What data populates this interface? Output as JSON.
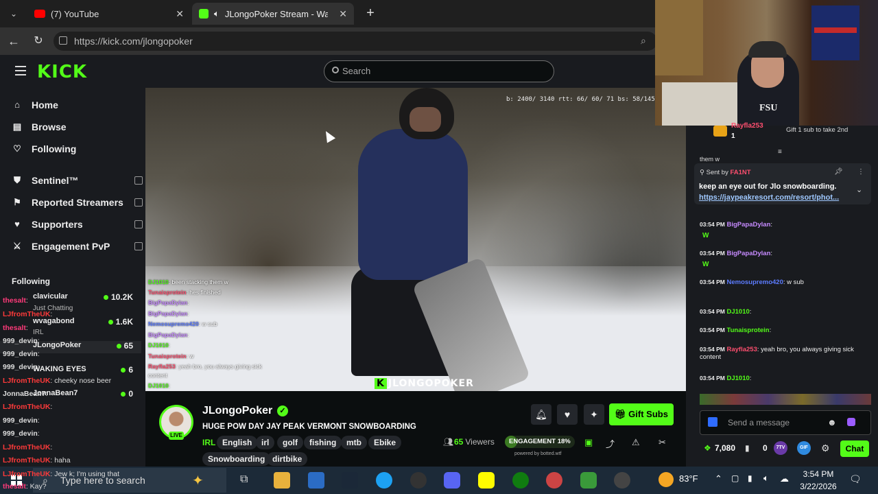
{
  "browser": {
    "tabs": [
      {
        "label": "(7) YouTube"
      },
      {
        "label": "JLongoPoker Stream - Watch"
      }
    ],
    "url": "https://kick.com/jlongopoker"
  },
  "kick": {
    "logo": "KICK",
    "search_placeholder": "Search",
    "nav": [
      {
        "label": "Home",
        "icon": "home-icon"
      },
      {
        "label": "Browse",
        "icon": "browse-icon"
      },
      {
        "label": "Following",
        "icon": "heart-icon"
      },
      {
        "label": "Sentinel™",
        "icon": "shield-icon"
      },
      {
        "label": "Reported Streamers",
        "icon": "flag-icon"
      },
      {
        "label": "Supporters",
        "icon": "heart-icon"
      },
      {
        "label": "Engagement PvP",
        "icon": "swords-icon"
      }
    ],
    "following_title": "Following",
    "following": [
      {
        "name": "clavicular",
        "count": "10.2K"
      },
      {
        "name": "wvagabond",
        "count": "1.6K"
      },
      {
        "name": "JLongoPoker",
        "count": "65"
      },
      {
        "name": "WAKING EYES",
        "count": "6"
      },
      {
        "name": "JonnaBean7",
        "count": "0"
      }
    ],
    "overlay_chat": [
      {
        "user": "thesalt",
        "text": ":"
      },
      {
        "user": "LJfromTheUK",
        "text": ":"
      },
      {
        "user": "thesalt",
        "text": ":"
      },
      {
        "user": "999_devin",
        "text": ":"
      },
      {
        "user": "999_devin",
        "text": ":"
      },
      {
        "user": "999_devin",
        "text": ":"
      },
      {
        "user": "LJfromTheUK",
        "text": ": cheeky nose beer"
      },
      {
        "user": "JonnaBean7",
        "text": ":"
      },
      {
        "user": "LJfromTheUK",
        "text": ":"
      },
      {
        "user": "999_devin",
        "text": ":"
      },
      {
        "user": "999_devin",
        "text": ":"
      },
      {
        "user": "LJfromTheUK",
        "text": ":"
      },
      {
        "user": "LJfromTheUK",
        "text": ": haha"
      },
      {
        "user": "LJfromTheUK",
        "text": ": Jew k; I'm using that"
      },
      {
        "user": "thesalt",
        "text": ": Kay?"
      }
    ],
    "overlay_extra": [
      "Just Chatting",
      "IRL"
    ]
  },
  "video": {
    "stats": "b: 2400/ 3140 rtt:  66/ 60/ 71 bs:  58/145/",
    "watermark": "JLONGOPOKER",
    "chat": [
      {
        "user": "DJ1010",
        "text": ": been stacking them w"
      },
      {
        "user": "Tunaisprotein",
        "text": ": hes finished"
      },
      {
        "user": "BigPapaDylan",
        "text": ":"
      },
      {
        "user": "BigPapaDylan",
        "text": ":"
      },
      {
        "user": "Nemosupremo420",
        "text": ": w sub"
      },
      {
        "user": "BigPapaDylan",
        "text": ":"
      },
      {
        "user": "DJ1010",
        "text": ":"
      },
      {
        "user": "Tunaisprotein",
        "text": ": w"
      },
      {
        "user": "Rayfla253",
        "text": ": yeah bro, you always giving sick"
      },
      {
        "user": "",
        "text": "content"
      },
      {
        "user": "DJ1010",
        "text": ":"
      }
    ]
  },
  "stream": {
    "name": "JLongoPoker",
    "live": "LIVE",
    "title": "HUGE POW DAY JAY PEAK VERMONT SNOWBOARDING",
    "category": "IRL",
    "tags": [
      "English",
      "irl",
      "golf",
      "fishing",
      "mtb",
      "Ebike",
      "Snowboarding",
      "dirtbike"
    ],
    "viewers": "65",
    "viewers_label": "Viewers",
    "engagement_label": "ENGAGEMENT 18%",
    "engagement_pct": 18,
    "powered_by": "powered by botted.wtf",
    "gift_subs": "Gift Subs"
  },
  "webcam": {
    "shirt_text": "FSU"
  },
  "chat": {
    "top_user": "Rayfla253",
    "top_count": "1",
    "gift_prompt": "Gift 1 sub to take 2nd",
    "cut_text": "them w",
    "pinned_label": "Sent by",
    "pinned_user": "FA1NT",
    "pinned_text": "keep an eye out for Jlo snowboarding.",
    "pinned_link": "https://jaypeakresort.com/resort/phot...",
    "messages": [
      {
        "time": "03:54 PM",
        "user": "BigPapaDylan",
        "text": ":",
        "color": "#c78bff"
      },
      {
        "time": "03:54 PM",
        "user": "BigPapaDylan",
        "text": ":",
        "color": "#c78bff"
      },
      {
        "time": "03:54 PM",
        "user": "Nemosupremo420",
        "text": ": w sub",
        "color": "#5c7cff"
      },
      {
        "time": "03:54 PM",
        "user": "DJ1010",
        "text": ":",
        "color": "#53fc18"
      },
      {
        "time": "03:54 PM",
        "user": "Tunaisprotein",
        "text": ":",
        "color": "#53fc18"
      },
      {
        "time": "03:54 PM",
        "user": "Rayfla253",
        "text": ": yeah bro, you always giving sick content",
        "color": "#ff4f6f"
      },
      {
        "time": "03:54 PM",
        "user": "DJ1010",
        "text": ":",
        "color": "#53fc18"
      }
    ],
    "input_placeholder": "Send a message",
    "points": "7,080",
    "zero": "0",
    "badges": [
      "7TV",
      "GIF"
    ],
    "chat_button": "Chat"
  },
  "taskbar": {
    "search_placeholder": "Type here to search",
    "weather": "83°F",
    "time": "3:54 PM",
    "date": "3/22/2026"
  },
  "colors": {
    "kick_green": "#53fc18",
    "bg": "#0b0e0f",
    "panel": "#191b1f"
  }
}
